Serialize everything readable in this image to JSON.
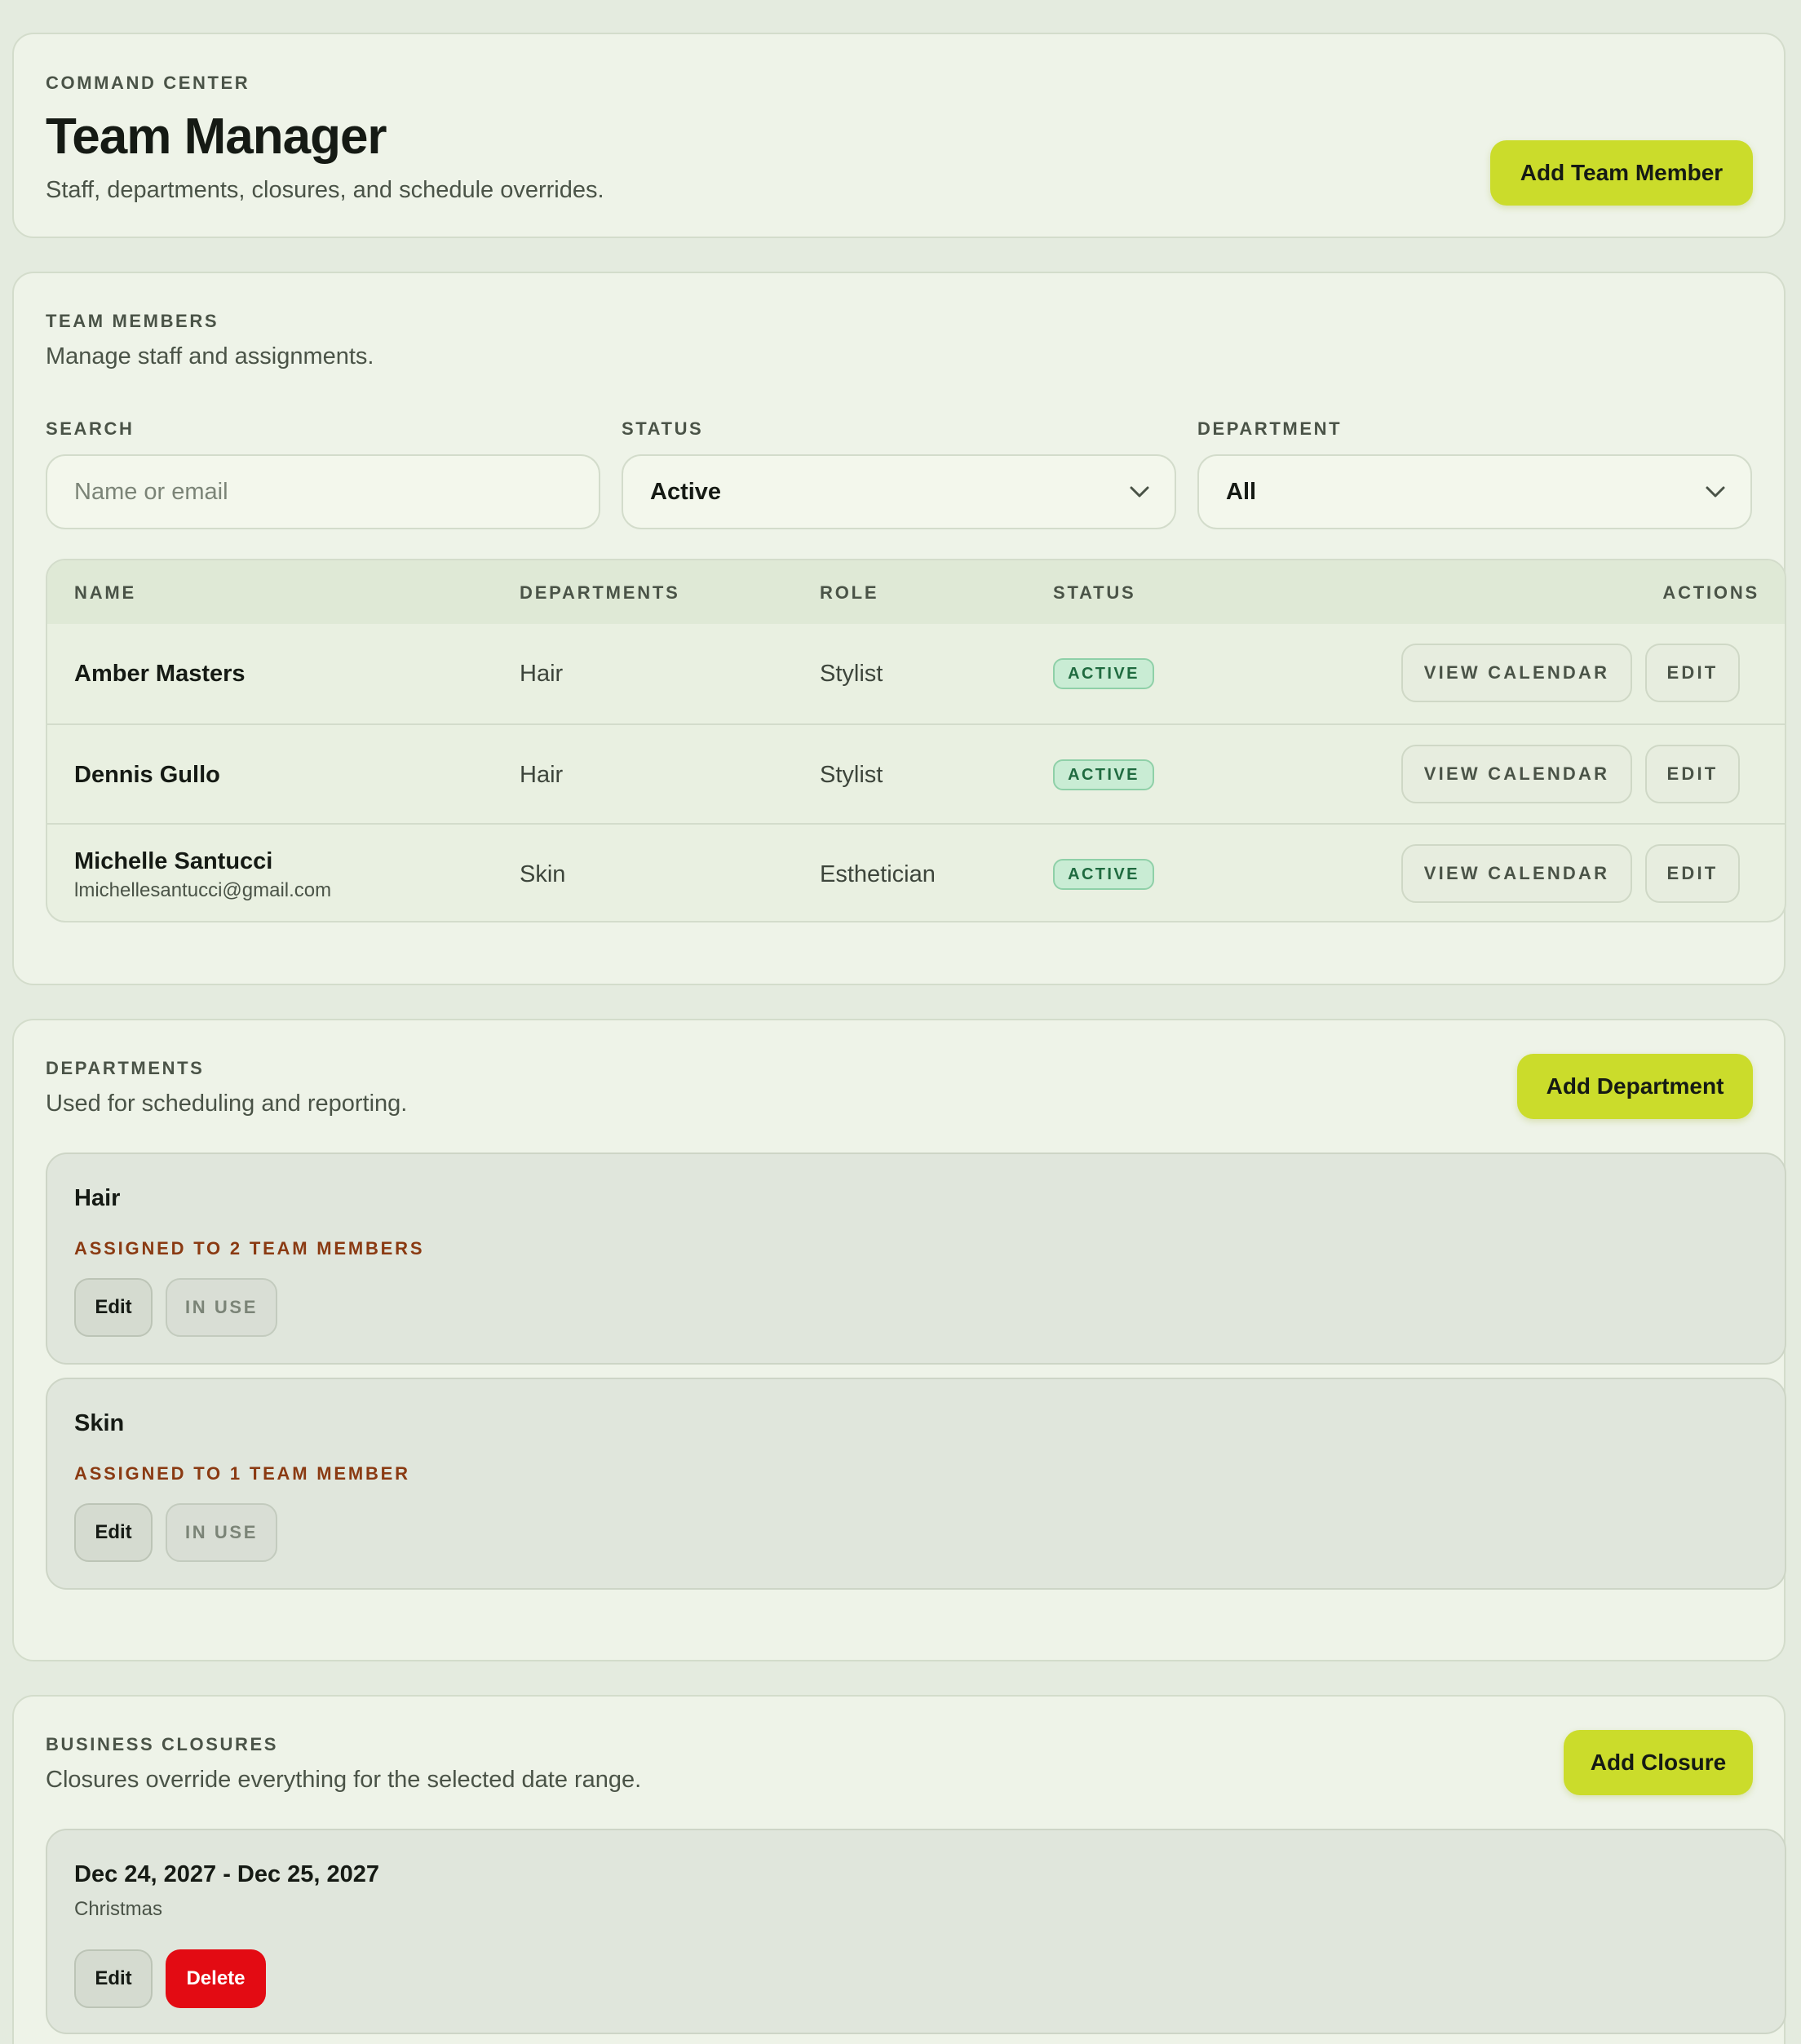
{
  "header": {
    "eyebrow": "COMMAND CENTER",
    "title": "Team Manager",
    "subtitle": "Staff, departments, closures, and schedule overrides.",
    "add_member_label": "Add Team Member"
  },
  "team": {
    "eyebrow": "TEAM MEMBERS",
    "subtitle": "Manage staff and assignments.",
    "filters": {
      "search_label": "SEARCH",
      "search_placeholder": "Name or email",
      "status_label": "STATUS",
      "status_value": "Active",
      "department_label": "DEPARTMENT",
      "department_value": "All"
    },
    "columns": [
      "NAME",
      "DEPARTMENTS",
      "ROLE",
      "STATUS",
      "ACTIONS"
    ],
    "rows": [
      {
        "name": "Amber Masters",
        "email": "",
        "departments": "Hair",
        "role": "Stylist",
        "status": "ACTIVE"
      },
      {
        "name": "Dennis Gullo",
        "email": "",
        "departments": "Hair",
        "role": "Stylist",
        "status": "ACTIVE"
      },
      {
        "name": "Michelle Santucci",
        "email": "lmichellesantucci@gmail.com",
        "departments": "Skin",
        "role": "Esthetician",
        "status": "ACTIVE"
      }
    ],
    "view_calendar_label": "VIEW CALENDAR",
    "edit_label": "EDIT"
  },
  "departments": {
    "eyebrow": "DEPARTMENTS",
    "subtitle": "Used for scheduling and reporting.",
    "add_label": "Add Department",
    "items": [
      {
        "name": "Hair",
        "assigned": "ASSIGNED TO 2 TEAM MEMBERS"
      },
      {
        "name": "Skin",
        "assigned": "ASSIGNED TO 1 TEAM MEMBER"
      }
    ],
    "edit_label": "Edit",
    "in_use_label": "IN USE"
  },
  "closures": {
    "eyebrow": "BUSINESS CLOSURES",
    "subtitle": "Closures override everything for the selected date range.",
    "add_label": "Add Closure",
    "items": [
      {
        "range": "Dec 24, 2027 - Dec 25, 2027",
        "note": "Christmas"
      }
    ],
    "edit_label": "Edit",
    "delete_label": "Delete"
  },
  "colors": {
    "accent": "#cbdc2b",
    "danger": "#e30b13",
    "active_badge": "#c9ecd4",
    "warning_text": "#8a3a12"
  }
}
